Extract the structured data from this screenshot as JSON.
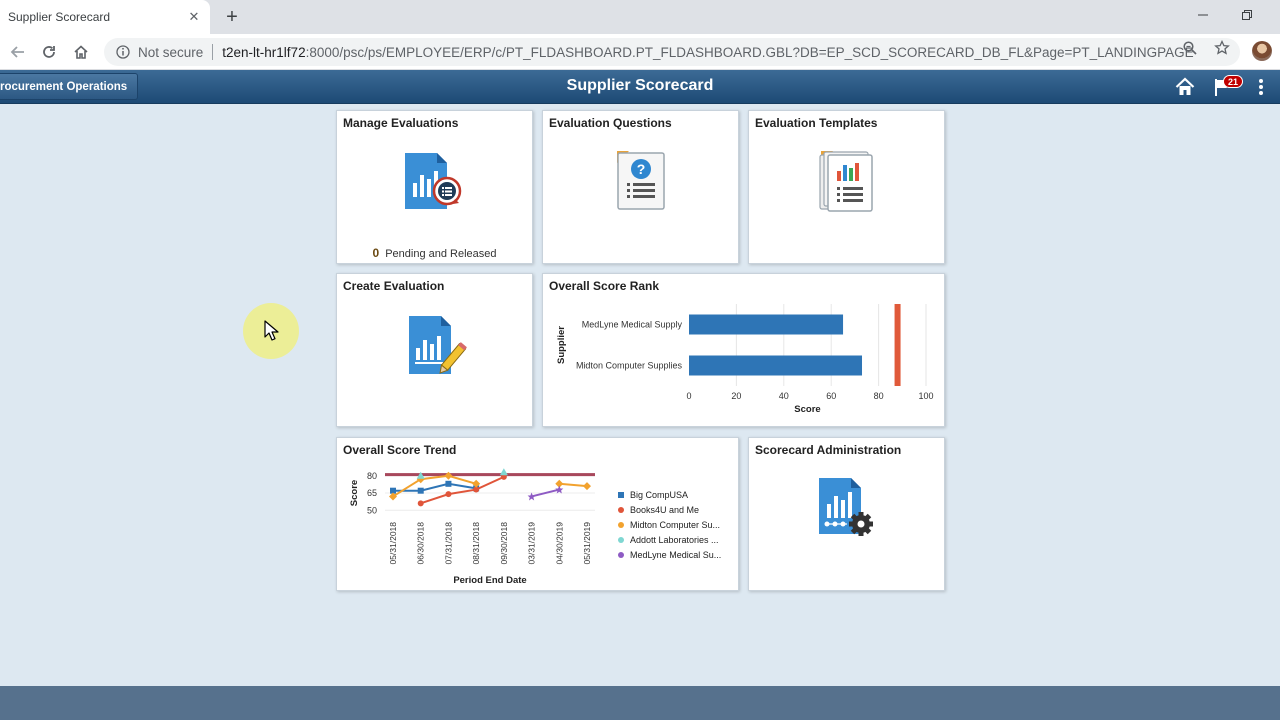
{
  "browser": {
    "tab_title": "Supplier Scorecard",
    "not_secure": "Not secure",
    "url_host": "t2en-lt-hr1lf72",
    "url_rest": ":8000/psc/ps/EMPLOYEE/ERP/c/PT_FLDASHBOARD.PT_FLDASHBOARD.GBL?DB=EP_SCD_SCORECARD_DB_FL&Page=PT_LANDINGPAGE"
  },
  "banner": {
    "nav_label": "rocurement Operations",
    "title": "Supplier Scorecard",
    "notification_count": "21"
  },
  "tiles": {
    "manage_evaluations": {
      "title": "Manage Evaluations",
      "count": "0",
      "count_label": "Pending and Released"
    },
    "evaluation_questions": {
      "title": "Evaluation Questions"
    },
    "evaluation_templates": {
      "title": "Evaluation Templates"
    },
    "create_evaluation": {
      "title": "Create Evaluation"
    },
    "overall_score_rank": {
      "title": "Overall Score Rank"
    },
    "overall_score_trend": {
      "title": "Overall Score Trend"
    },
    "scorecard_administration": {
      "title": "Scorecard Administration"
    }
  },
  "colors": {
    "banner": "#1d4a75",
    "tile_icon_blue": "#3a8fd6",
    "rank_bar": "#2e75b6",
    "target_line": "#e05a3a"
  },
  "chart_data": [
    {
      "type": "bar",
      "orientation": "horizontal",
      "categories": [
        "MedLyne Medical Supply",
        "Midton Computer Supplies"
      ],
      "values": [
        65,
        73
      ],
      "reference_line": 88,
      "xlabel": "Score",
      "ylabel": "Supplier",
      "xlim": [
        0,
        100
      ],
      "xticks": [
        0,
        20,
        40,
        60,
        80,
        100
      ],
      "grid": true
    },
    {
      "type": "line",
      "x": [
        "05/31/2018",
        "06/30/2018",
        "07/31/2018",
        "08/31/2018",
        "09/30/2018",
        "03/31/2019",
        "04/30/2019",
        "05/31/2019"
      ],
      "xlabel": "Period End Date",
      "ylabel": "Score",
      "yticks": [
        50,
        65,
        80
      ],
      "ylim": [
        45,
        85
      ],
      "reference_line": 81,
      "legend": "right",
      "series": [
        {
          "name": "Big CompUSA",
          "color": "#2e75b6",
          "marker": "square",
          "values": [
            67,
            67,
            73,
            69,
            null,
            null,
            null,
            null
          ]
        },
        {
          "name": "Books4U and Me",
          "color": "#e0553a",
          "marker": "circle",
          "values": [
            null,
            56,
            64,
            68,
            79,
            null,
            null,
            null
          ]
        },
        {
          "name": "Midton Computer Su...",
          "color": "#f2a22e",
          "marker": "diamond",
          "values": [
            62,
            77,
            80,
            73,
            null,
            null,
            73,
            71
          ]
        },
        {
          "name": "Addott Laboratories ...",
          "color": "#7fd7d2",
          "marker": "triangle",
          "values": [
            null,
            80,
            null,
            null,
            83,
            null,
            null,
            null
          ]
        },
        {
          "name": "MedLyne Medical Su...",
          "color": "#8e5bc4",
          "marker": "star",
          "values": [
            null,
            null,
            null,
            null,
            null,
            62,
            68,
            null
          ]
        }
      ]
    }
  ]
}
